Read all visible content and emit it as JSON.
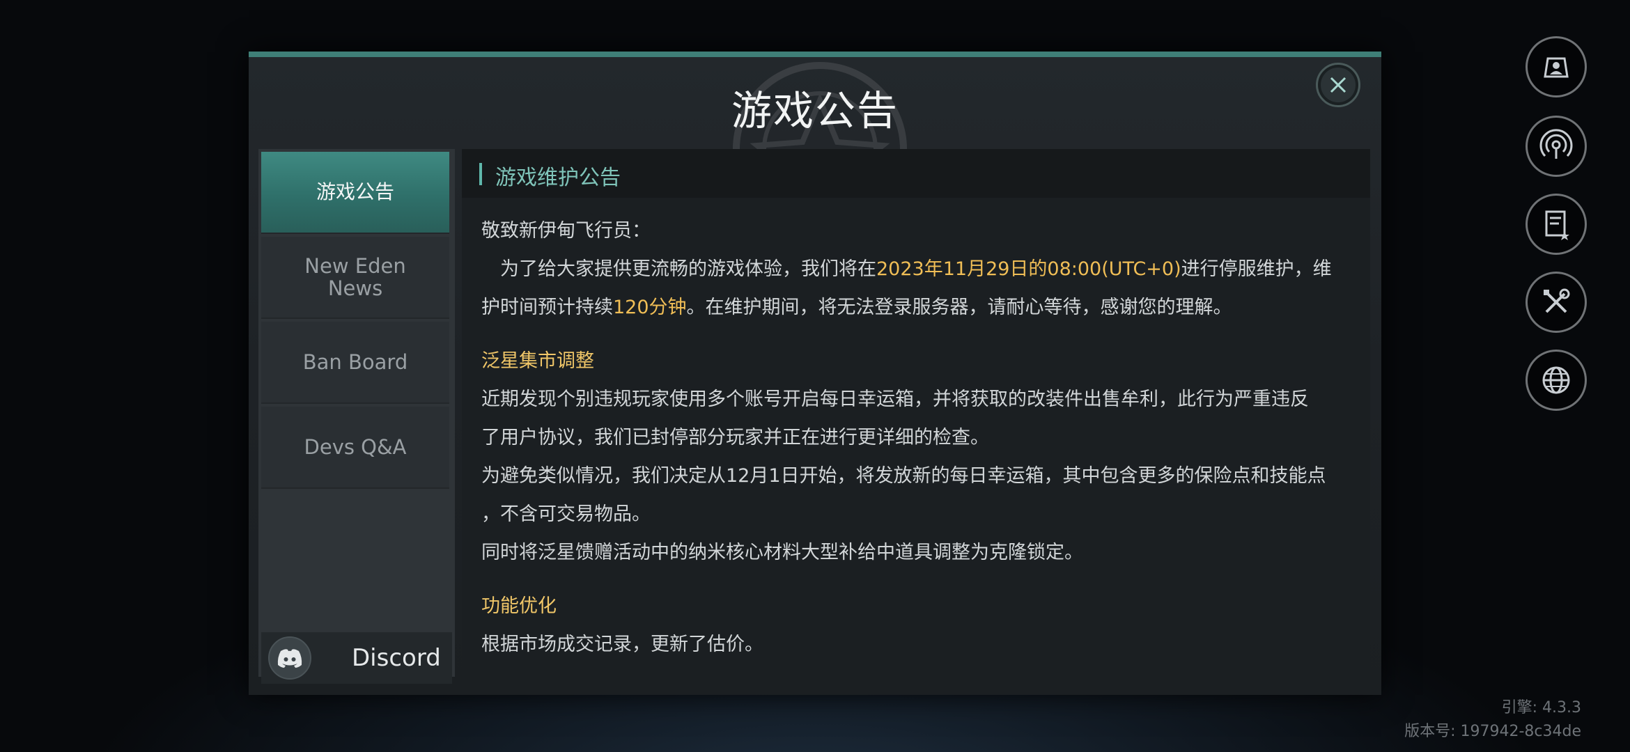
{
  "modal": {
    "title": "游戏公告"
  },
  "sidebar": {
    "tabs": [
      {
        "label": "游戏公告",
        "active": true
      },
      {
        "label": "New Eden\nNews",
        "active": false
      },
      {
        "label": "Ban Board",
        "active": false
      },
      {
        "label": "Devs Q&A",
        "active": false
      }
    ],
    "discord_label": "Discord"
  },
  "content": {
    "title": "游戏维护公告",
    "greeting": "敬致新伊甸飞行员：",
    "p1_a": "为了给大家提供更流畅的游戏体验，我们将在",
    "p1_highlight1": "2023年11月29日的08:00(UTC+0)",
    "p1_b": "进行停服维护，维",
    "p1_c": "护时间预计持续",
    "p1_highlight2": "120分钟",
    "p1_d": "。在维护期间，将无法登录服务器，请耐心等待，感谢您的理解。",
    "section1_title": "泛星集市调整",
    "section1_l1": "近期发现个别违规玩家使用多个账号开启每日幸运箱，并将获取的改装件出售牟利，此行为严重违反",
    "section1_l2": "了用户协议，我们已封停部分玩家并正在进行更详细的检查。",
    "section1_l3": "为避免类似情况，我们决定从12月1日开始，将发放新的每日幸运箱，其中包含更多的保险点和技能点",
    "section1_l4": "，不含可交易物品。",
    "section1_l5": "同时将泛星馈赠活动中的纳米核心材料大型补给中道具调整为克隆锁定。",
    "section2_title": "功能优化",
    "section2_l1": "根据市场成交记录，更新了估价。"
  },
  "footer": {
    "engine": "引擎: 4.3.3",
    "version": "版本号: 197942-8c34de"
  },
  "hud_icons": [
    "profile-icon",
    "signal-icon",
    "notice-icon",
    "tools-icon",
    "globe-icon"
  ],
  "colors": {
    "accent": "#3f8a82",
    "highlight": "#f0be56",
    "section_title": "#f0c668"
  }
}
